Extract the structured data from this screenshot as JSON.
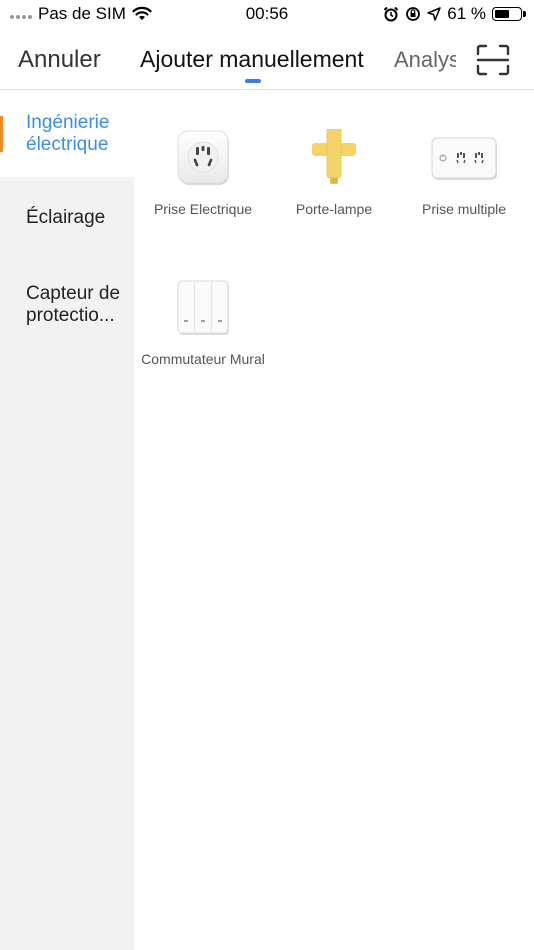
{
  "status_bar": {
    "carrier": "Pas de SIM",
    "time": "00:56",
    "battery_percent": "61 %",
    "battery_level": 0.61,
    "icons": [
      "wifi-icon",
      "alarm-icon",
      "orientation-lock-icon",
      "location-icon",
      "battery-icon"
    ]
  },
  "header": {
    "cancel_label": "Annuler",
    "active_tab": "Ajouter manuellement",
    "other_tab": "Analyser",
    "scan_icon": "scan-icon"
  },
  "sidebar": {
    "items": [
      {
        "label": "Ingénierie électrique",
        "active": true
      },
      {
        "label": "Éclairage",
        "active": false
      },
      {
        "label": "Capteur de protectio...",
        "active": false
      }
    ]
  },
  "products": [
    {
      "label": "Prise Electrique",
      "icon": "power-socket-icon"
    },
    {
      "label": "Porte-lampe",
      "icon": "lamp-holder-icon"
    },
    {
      "label": "Prise multiple",
      "icon": "power-strip-icon"
    },
    {
      "label": "Commutateur Mural",
      "icon": "wall-switch-icon"
    }
  ],
  "colors": {
    "accent_blue": "#3a8ee6",
    "tab_indicator": "#3a7fe6",
    "sidebar_accent": "#f08a24",
    "sidebar_bg": "#f2f2f2",
    "lamp_yellow": "#f4d468"
  }
}
